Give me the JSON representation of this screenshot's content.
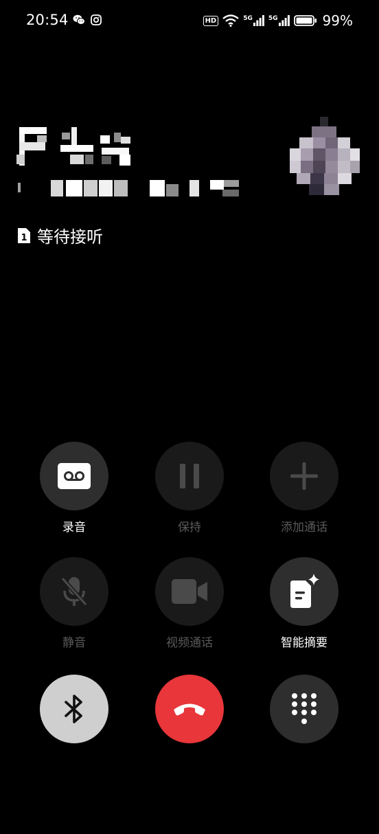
{
  "status_bar": {
    "time": "20:54",
    "hd_label": "HD",
    "network_1": "5G",
    "network_2": "5G",
    "battery_percent": "99%"
  },
  "caller": {
    "status_text": "等待接听",
    "sim_slot": "1"
  },
  "controls": [
    {
      "label": "录音",
      "icon": "record-icon",
      "enabled": true
    },
    {
      "label": "保持",
      "icon": "pause-icon",
      "enabled": false
    },
    {
      "label": "添加通话",
      "icon": "add-call-icon",
      "enabled": false
    },
    {
      "label": "静音",
      "icon": "mute-icon",
      "enabled": false
    },
    {
      "label": "视频通话",
      "icon": "video-icon",
      "enabled": false
    },
    {
      "label": "智能摘要",
      "icon": "smart-summary-icon",
      "enabled": true
    }
  ],
  "bottom_actions": [
    {
      "name": "bluetooth",
      "icon": "bluetooth-icon",
      "color": "#cfcfcf"
    },
    {
      "name": "end-call",
      "icon": "hang-up-icon",
      "color": "#e8363a"
    },
    {
      "name": "dialpad",
      "icon": "dialpad-icon",
      "color": "#2e2e2e"
    }
  ],
  "colors": {
    "background": "#000000",
    "end_call": "#e8363a",
    "bluetooth_active": "#cfcfcf",
    "button_active": "#2e2e2e",
    "button_disabled": "#1a1a1a",
    "label_disabled": "#5a5a5a"
  }
}
